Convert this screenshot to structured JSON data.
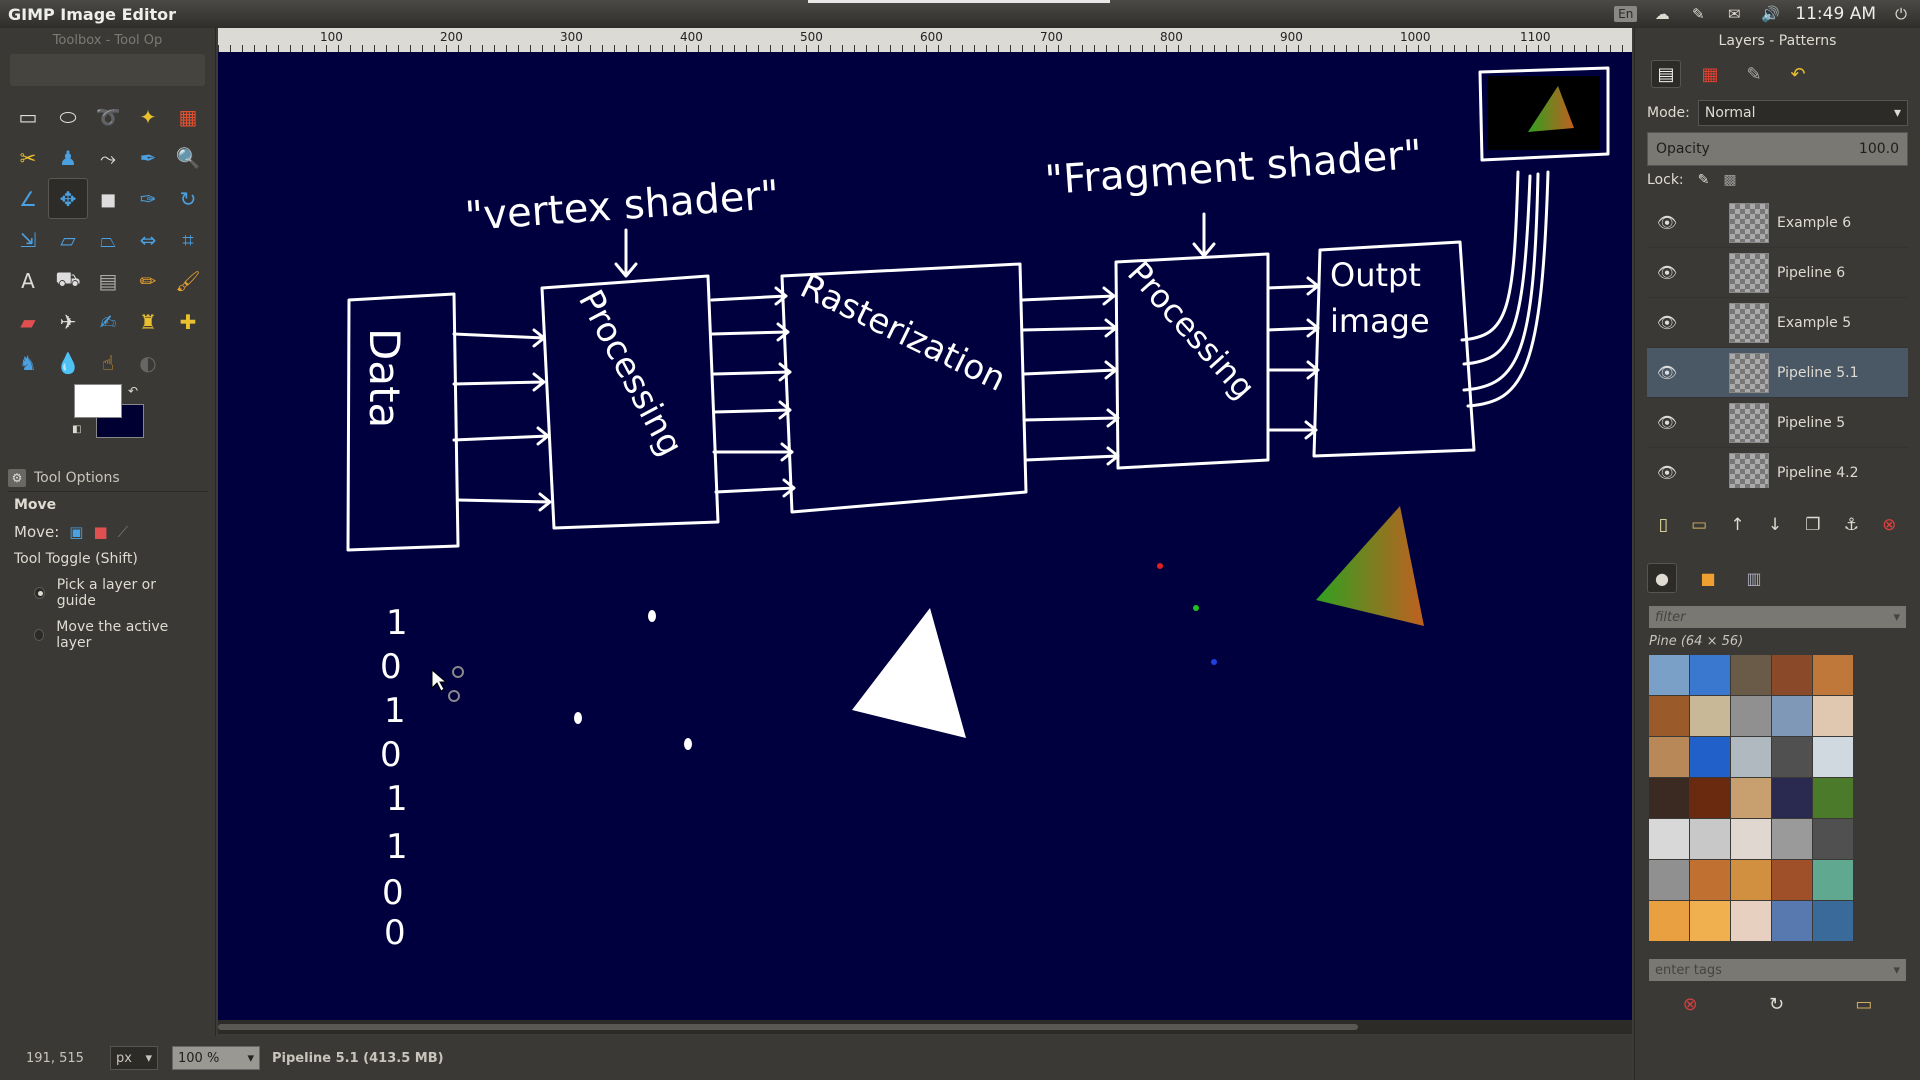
{
  "window": {
    "title": "GIMP Image Editor"
  },
  "tray": {
    "keyboard": "En",
    "time": "11:49 AM"
  },
  "toolbox": {
    "title": "Toolbox - Tool Op"
  },
  "tool_options": {
    "header": "Tool Options",
    "tool_name": "Move",
    "move_label": "Move:",
    "toggle_label": "Tool Toggle  (Shift)",
    "option_pick": "Pick a layer or guide",
    "option_active": "Move the active layer"
  },
  "ruler": {
    "labels": [
      "100",
      "200",
      "300",
      "400",
      "500",
      "600",
      "700",
      "800",
      "900",
      "1000",
      "1100"
    ]
  },
  "drawing": {
    "vertex_label": "\"vertex shader\"",
    "fragment_label": "\"Fragment shader\"",
    "box_data": "Data",
    "box_processing1": "Processing",
    "box_raster": "Rasterization",
    "box_processing2": "Processing",
    "box_output": "Output image",
    "bits": [
      "1",
      "0",
      "1",
      "0",
      "1",
      "1",
      "0",
      "0"
    ]
  },
  "statusbar": {
    "coords": "191, 515",
    "unit": "px",
    "zoom": "100 %",
    "status": "Pipeline 5.1 (413.5 MB)"
  },
  "layers_dock": {
    "title": "Layers - Patterns",
    "mode_label": "Mode:",
    "mode_value": "Normal",
    "opacity_label": "Opacity",
    "opacity_value": "100.0",
    "lock_label": "Lock:",
    "layers": [
      {
        "name": "Example 6",
        "selected": false
      },
      {
        "name": "Pipeline 6",
        "selected": false
      },
      {
        "name": "Example 5",
        "selected": false
      },
      {
        "name": "Pipeline 5.1",
        "selected": true
      },
      {
        "name": "Pipeline 5",
        "selected": false
      },
      {
        "name": "Pipeline 4.2",
        "selected": false
      }
    ]
  },
  "patterns": {
    "filter_placeholder": "filter",
    "current": "Pine (64 × 56)",
    "tags_placeholder": "enter tags",
    "swatch_colors": [
      "#7aa0c8",
      "#3a78d0",
      "#6a5a48",
      "#8a4a2a",
      "#c0783a",
      "#9a5a2a",
      "#c8b898",
      "#909090",
      "#8098b8",
      "#e0c8b0",
      "#b88858",
      "#2060c8",
      "#b0b8c0",
      "#505050",
      "#d0d8e0",
      "#3a2a22",
      "#6a2a10",
      "#c8a070",
      "#2a2a50",
      "#4a7a2a",
      "#d8d8d8",
      "#c8c8c8",
      "#e0d8d0",
      "#9a9a9a",
      "#505050",
      "#909090",
      "#c07030",
      "#d09040",
      "#a05028",
      "#60a890",
      "#e8a040",
      "#f0b050",
      "#e8d0c0",
      "#5878b0",
      "#3a6a9a"
    ]
  }
}
